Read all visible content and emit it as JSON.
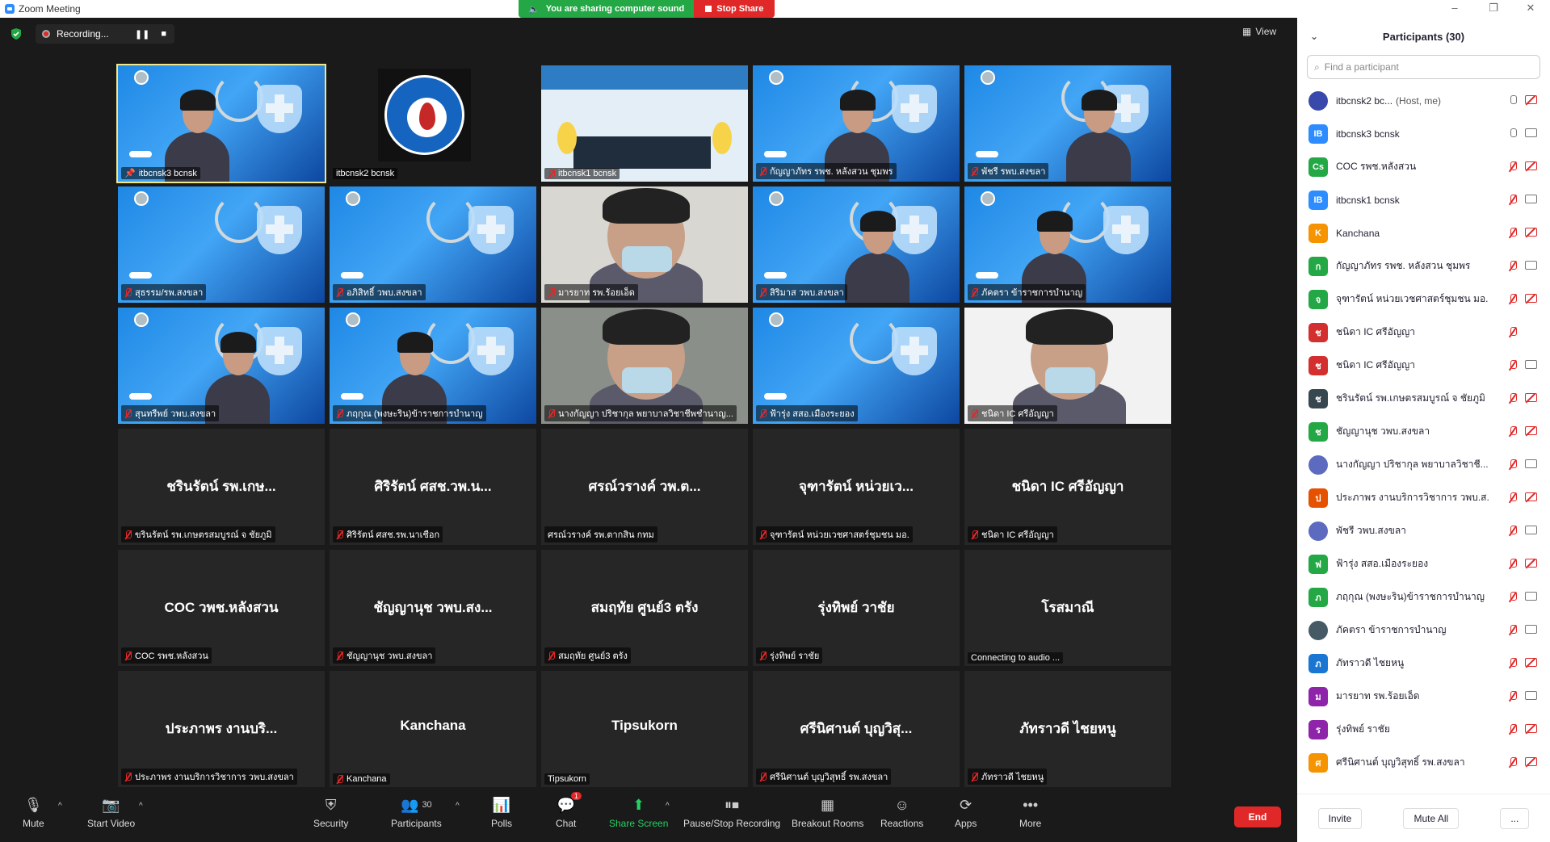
{
  "window": {
    "title": "Zoom Meeting"
  },
  "share_banner": {
    "sound": "You are sharing computer sound",
    "stop": "Stop Share"
  },
  "recording": {
    "label": "Recording..."
  },
  "view": {
    "label": "View"
  },
  "tiles": [
    {
      "name": "itbcnsk3 bcnsk",
      "kind": "poster-person",
      "active": true,
      "muted": false,
      "pinned": true
    },
    {
      "name": "itbcnsk2 bcnsk",
      "kind": "logo",
      "muted": false
    },
    {
      "name": "itbcnsk1 bcnsk",
      "kind": "room",
      "muted": true
    },
    {
      "name": "กัญญาภัทร รพช. หลังสวน ชุมพร",
      "kind": "poster-person",
      "muted": true
    },
    {
      "name": "พัชรี รพบ.สงขลา",
      "kind": "poster-person",
      "muted": true
    },
    {
      "name": "สุธรรม/รพ.สงขลา",
      "kind": "poster",
      "muted": true
    },
    {
      "name": "อภิสิทธิ์ วพบ.สงขลา",
      "kind": "poster",
      "muted": true
    },
    {
      "name": "มารยาท รพ.ร้อยเอ็ด",
      "kind": "face",
      "muted": true
    },
    {
      "name": "สิริมาส วพบ.สงขลา",
      "kind": "poster-person",
      "muted": true
    },
    {
      "name": "ภัคตรา ข้าราชการบำนาญ",
      "kind": "poster-person",
      "muted": true
    },
    {
      "name": "สุนทรีพย์ วพบ.สงขลา",
      "kind": "poster-person",
      "muted": true
    },
    {
      "name": "ภฤกุณ (พงษะริน)ข้าราชการบำนาญ",
      "kind": "poster-person",
      "muted": true
    },
    {
      "name": "นางกัญญา ปริชากุล พยาบาลวิชาชีพชำนาญ...",
      "kind": "face",
      "muted": true
    },
    {
      "name": "ฟ้ารุ่ง สสอ.เมืองระยอง",
      "kind": "poster",
      "muted": true
    },
    {
      "name": "ชนิดา IC ศรีอัญญา",
      "kind": "face",
      "muted": true
    },
    {
      "name": "ขรินรัตน์ รพ.เกษตรสมบูรณ์ จ ชัยภูมิ",
      "big": "ชรินรัตน์ รพ.เกษ...",
      "kind": "name",
      "muted": true
    },
    {
      "name": "ศิริรัตน์ ศสช.รพ.นาเชือก",
      "big": "ศิริรัตน์ ศสช.วพ.น...",
      "kind": "name",
      "muted": true
    },
    {
      "name": "ศรณ์วรางค์ รพ.ตากสิน กทม",
      "big": "ศรณ์วรางค์ วพ.ต...",
      "kind": "name",
      "muted": false
    },
    {
      "name": "จุฑารัตน์ หน่วยเวชศาสตร์ชุมชน มอ.",
      "big": "จุฑารัตน์ หน่วยเว...",
      "kind": "name",
      "muted": true
    },
    {
      "name": "ชนิดา IC ศรีอัญญา",
      "big": "ชนิดา IC ศรีอัญญา",
      "kind": "name",
      "muted": true
    },
    {
      "name": "COC รพช.หลังสวน",
      "big": "COC วพช.หลังสวน",
      "kind": "name",
      "muted": true
    },
    {
      "name": "ชัญญานุช วพบ.สงขลา",
      "big": "ชัญญานุช วพบ.สง...",
      "kind": "name",
      "muted": true
    },
    {
      "name": "สมฤทัย ศูนย์3 ตรัง",
      "big": "สมฤทัย ศูนย์3 ตรัง",
      "kind": "name",
      "muted": true
    },
    {
      "name": "รุ่งทิพย์ ราชัย",
      "big": "รุ่งทิพย์ วาชัย",
      "kind": "name",
      "muted": true
    },
    {
      "name": "Connecting to audio ...",
      "big": "โรสมาณี",
      "kind": "name",
      "muted": false
    },
    {
      "name": "ประภาพร งานบริการวิชาการ วพบ.สงขลา",
      "big": "ประภาพร งานบริ...",
      "kind": "name",
      "muted": true
    },
    {
      "name": "Kanchana",
      "big": "Kanchana",
      "kind": "name",
      "muted": true
    },
    {
      "name": "Tipsukorn",
      "big": "Tipsukorn",
      "kind": "name",
      "muted": false
    },
    {
      "name": "ศรีนิศานต์ บุญวิสุทธิ์ รพ.สงขลา",
      "big": "ศรีนิศานต์ บุญวิสุ...",
      "kind": "name",
      "muted": true
    },
    {
      "name": "ภัทราวดี ไชยหนู",
      "big": "ภัทราวดี ไชยหนู",
      "kind": "name",
      "muted": true
    }
  ],
  "panel": {
    "title": "Participants (30)",
    "search_placeholder": "Find a participant",
    "participants": [
      {
        "initial": "",
        "color": "#3949ab",
        "name": "itbcnsk2 bc...",
        "note": "(Host, me)",
        "mic": "on",
        "cam": "off",
        "photo": true
      },
      {
        "initial": "IB",
        "color": "#2d8cff",
        "name": "itbcnsk3 bcnsk",
        "mic": "on",
        "cam": "on"
      },
      {
        "initial": "Cs",
        "color": "#23a845",
        "name": "COC รพช.หลังสวน",
        "mic": "off",
        "cam": "off"
      },
      {
        "initial": "IB",
        "color": "#2d8cff",
        "name": "itbcnsk1 bcnsk",
        "mic": "off",
        "cam": "on"
      },
      {
        "initial": "K",
        "color": "#f59300",
        "name": "Kanchana",
        "mic": "off",
        "cam": "off"
      },
      {
        "initial": "ก",
        "color": "#23a845",
        "name": "กัญญาภัทร รพช. หลังสวน ชุมพร",
        "mic": "off",
        "cam": "on"
      },
      {
        "initial": "จ",
        "color": "#23a845",
        "name": "จุฑารัตน์ หน่วยเวชศาสตร์ชุมชน มอ.",
        "mic": "off",
        "cam": "off"
      },
      {
        "initial": "ช",
        "color": "#d32f2f",
        "name": "ชนิดา IC ศรีอัญญา",
        "mic": "off",
        "cam": "none"
      },
      {
        "initial": "ช",
        "color": "#d32f2f",
        "name": "ชนิดา IC ศรีอัญญา",
        "mic": "off",
        "cam": "on"
      },
      {
        "initial": "ช",
        "color": "#37474f",
        "name": "ชรินรัตน์ รพ.เกษตรสมบูรณ์ จ ชัยภูมิ",
        "mic": "off",
        "cam": "off"
      },
      {
        "initial": "ช",
        "color": "#23a845",
        "name": "ชัญญานุช วพบ.สงขลา",
        "mic": "off",
        "cam": "off"
      },
      {
        "initial": "",
        "color": "#5c6bc0",
        "name": "นางกัญญา ปริชากุล พยาบาลวิชาชี...",
        "mic": "off",
        "cam": "on",
        "photo": true
      },
      {
        "initial": "ป",
        "color": "#e65100",
        "name": "ประภาพร งานบริการวิชาการ วพบ.ส...",
        "mic": "off",
        "cam": "off"
      },
      {
        "initial": "",
        "color": "#5c6bc0",
        "name": "พัชรี วพบ.สงขลา",
        "mic": "off",
        "cam": "on",
        "photo": true
      },
      {
        "initial": "ฟ",
        "color": "#23a845",
        "name": "ฟ้ารุ่ง สสอ.เมืองระยอง",
        "mic": "off",
        "cam": "off"
      },
      {
        "initial": "ภ",
        "color": "#23a845",
        "name": "ภฤกุณ (พงษะริน)ข้าราชการบำนาญ",
        "mic": "off",
        "cam": "on"
      },
      {
        "initial": "",
        "color": "#455a64",
        "name": "ภัคตรา ข้าราชการบำนาญ",
        "mic": "off",
        "cam": "on",
        "photo": true
      },
      {
        "initial": "ภ",
        "color": "#1976d2",
        "name": "ภัทราวดี ไชยหนู",
        "mic": "off",
        "cam": "off"
      },
      {
        "initial": "ม",
        "color": "#8e24aa",
        "name": "มารยาท รพ.ร้อยเอ็ด",
        "mic": "off",
        "cam": "on"
      },
      {
        "initial": "ร",
        "color": "#8e24aa",
        "name": "รุ่งทิพย์ ราชัย",
        "mic": "off",
        "cam": "off"
      },
      {
        "initial": "ศ",
        "color": "#f59300",
        "name": "ศรีนิศานต์ บุญวิสุทธิ์ รพ.สงขลา",
        "mic": "off",
        "cam": "off"
      }
    ],
    "invite": "Invite",
    "mute_all": "Mute All",
    "more": "..."
  },
  "toolbar": {
    "mute": "Mute",
    "start_video": "Start Video",
    "security": "Security",
    "participants": "Participants",
    "participants_count": "30",
    "polls": "Polls",
    "chat": "Chat",
    "chat_badge": "1",
    "share_screen": "Share Screen",
    "pause_stop_recording": "Pause/Stop Recording",
    "breakout_rooms": "Breakout Rooms",
    "reactions": "Reactions",
    "apps": "Apps",
    "more": "More",
    "end": "End"
  }
}
